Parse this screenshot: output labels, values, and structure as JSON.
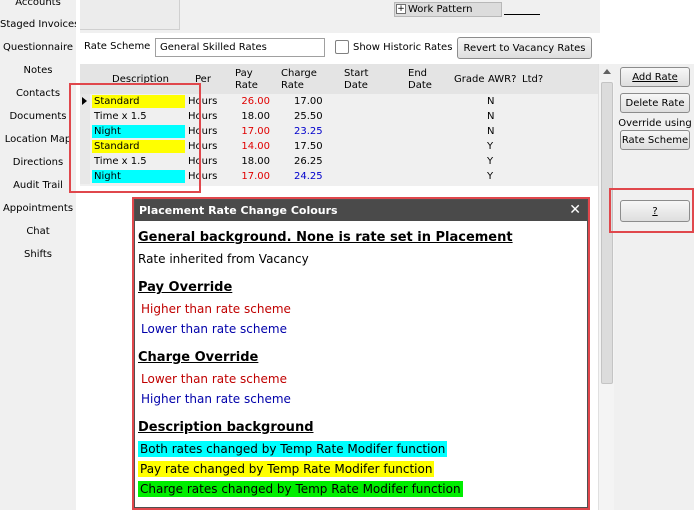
{
  "colors": {
    "yellow": "#ffff00",
    "cyan": "#00ffff",
    "green": "#00ee00",
    "red_text": "#e00000",
    "blue_text": "#0000cc",
    "highlight_border": "#e0474c"
  },
  "nav": {
    "items": [
      {
        "label": "Accounts"
      },
      {
        "label": "Staged Invoices"
      },
      {
        "label": "Questionnaire"
      },
      {
        "label": "Notes"
      },
      {
        "label": "Contacts"
      },
      {
        "label": "Documents"
      },
      {
        "label": "Location Map"
      },
      {
        "label": "Directions"
      },
      {
        "label": "Audit Trail"
      },
      {
        "label": "Appointments"
      },
      {
        "label": "Chat"
      },
      {
        "label": "Shifts"
      }
    ]
  },
  "top": {
    "work_pattern_label": "Work Pattern",
    "plus_glyph": "+"
  },
  "form": {
    "rate_scheme_label": "Rate Scheme",
    "rate_scheme_value": "General Skilled Rates",
    "show_historic_label": "Show Historic Rates",
    "revert_button": "Revert to Vacancy Rates"
  },
  "grid": {
    "headers": {
      "description": "Description",
      "per": "Per",
      "pay_rate": "Pay\nRate",
      "charge_rate": "Charge\nRate",
      "start_date": "Start\nDate",
      "end_date": "End\nDate",
      "grade": "Grade",
      "awr": "AWR?",
      "ltd": "Ltd?"
    },
    "rows": [
      {
        "description": "Standard",
        "per": "Hours",
        "pay": "26.00",
        "charge": "17.00",
        "awr": "N",
        "desc_bg": "yellow",
        "pay_color": "red",
        "charge_color": "black",
        "selected": true
      },
      {
        "description": "Time x 1.5",
        "per": "Hours",
        "pay": "18.00",
        "charge": "25.50",
        "awr": "N",
        "desc_bg": "none",
        "pay_color": "black",
        "charge_color": "black",
        "selected": false
      },
      {
        "description": "Night",
        "per": "Hours",
        "pay": "17.00",
        "charge": "23.25",
        "awr": "N",
        "desc_bg": "cyan",
        "pay_color": "red",
        "charge_color": "blue",
        "selected": false
      },
      {
        "description": "Standard",
        "per": "Hours",
        "pay": "14.00",
        "charge": "17.50",
        "awr": "Y",
        "desc_bg": "yellow",
        "pay_color": "red",
        "charge_color": "black",
        "selected": false
      },
      {
        "description": "Time x 1.5",
        "per": "Hours",
        "pay": "18.00",
        "charge": "26.25",
        "awr": "Y",
        "desc_bg": "none",
        "pay_color": "black",
        "charge_color": "black",
        "selected": false
      },
      {
        "description": "Night",
        "per": "Hours",
        "pay": "17.00",
        "charge": "24.25",
        "awr": "Y",
        "desc_bg": "cyan",
        "pay_color": "red",
        "charge_color": "blue",
        "selected": false
      }
    ]
  },
  "buttons": {
    "add_rate": "Add Rate",
    "delete_rate": "Delete Rate",
    "override_using": "Override using",
    "rate_scheme": "Rate Scheme",
    "help": "?"
  },
  "popup": {
    "title": "Placement Rate Change Colours",
    "close_glyph": "✕",
    "general_heading": "General background. None is rate set in Placement",
    "general_text": "Rate inherited from Vacancy",
    "pay_heading": "Pay Override",
    "pay_higher": "Higher than rate scheme",
    "pay_lower": "Lower than rate scheme",
    "charge_heading": "Charge Override",
    "charge_lower": "Lower than rate scheme",
    "charge_higher": "Higher than rate scheme",
    "desc_heading": "Description background",
    "desc_both": "Both rates changed by Temp Rate Modifer function",
    "desc_pay": "Pay rate changed by Temp Rate Modifer function",
    "desc_charge": "Charge rates changed by Temp Rate Modifer function"
  }
}
